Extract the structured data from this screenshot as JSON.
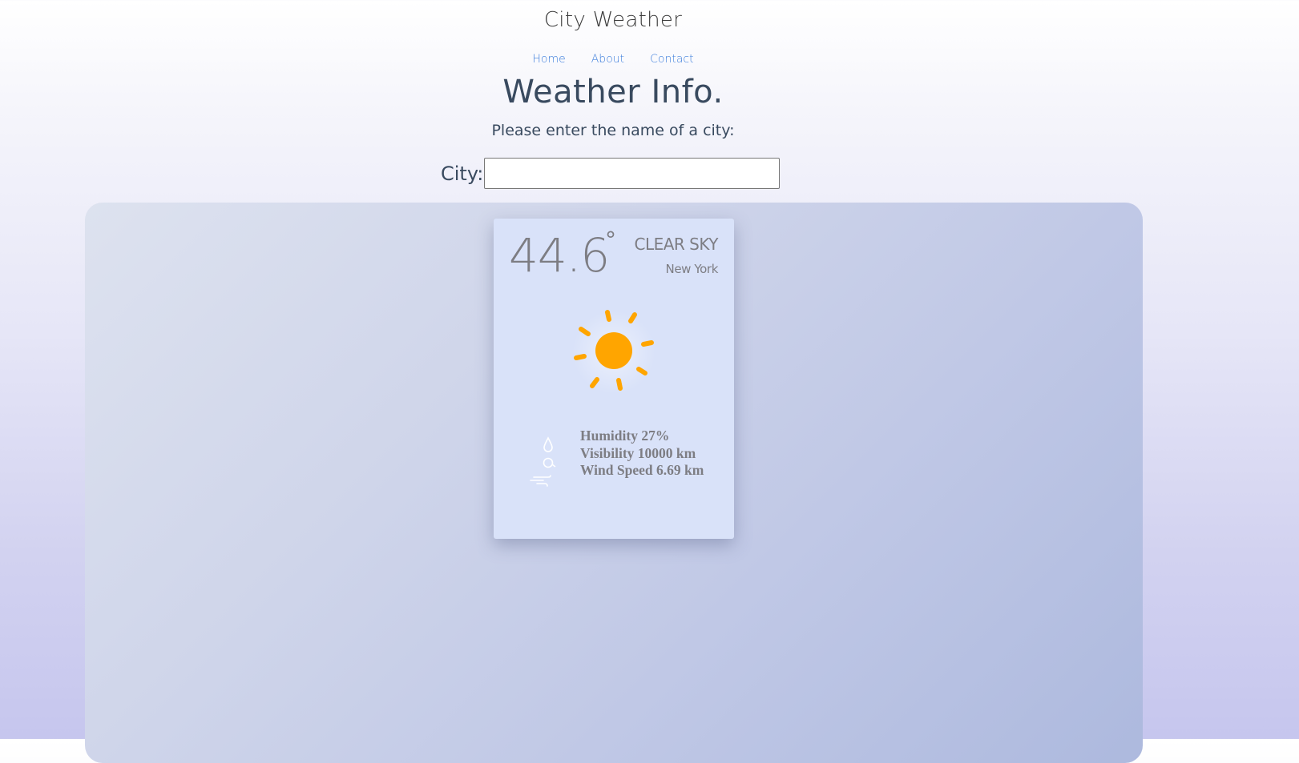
{
  "site": {
    "title": "City Weather"
  },
  "nav": {
    "items": [
      "Home",
      "About",
      "Contact"
    ]
  },
  "main": {
    "heading": "Weather Info.",
    "prompt": "Please enter the name of a city:",
    "city_label": "City:",
    "city_input_value": "",
    "city_input_placeholder": ""
  },
  "weather_card": {
    "temperature": "44.6",
    "degree_symbol": "°",
    "condition": "CLEAR SKY",
    "location": "New York",
    "humidity_text": "Humidity 27%",
    "visibility_text": "Visibility 10000 km",
    "wind_text": "Wind Speed 6.69 km",
    "icons": [
      "sun-icon",
      "water-drop-icon",
      "humidity-icon",
      "wind-icon"
    ]
  },
  "colors": {
    "link": "#3f7fdc",
    "heading": "#394a5f",
    "card_bg": "#d9e2f9",
    "card_text": "#7d7d83",
    "sun": "#ffa500"
  }
}
